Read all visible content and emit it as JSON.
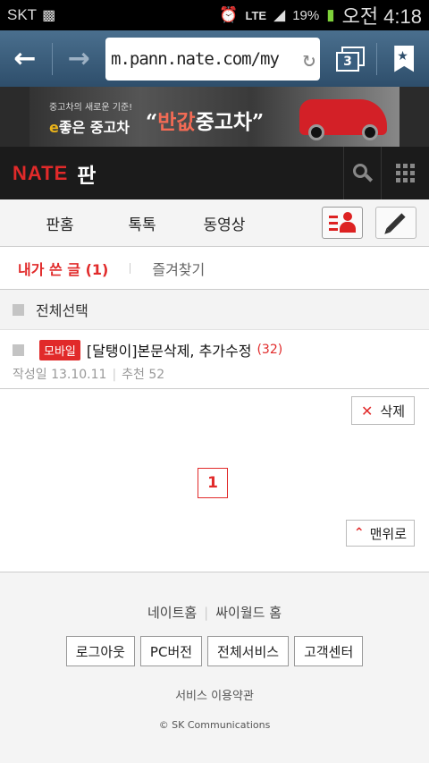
{
  "status_bar": {
    "carrier": "SKT",
    "network": "LTE",
    "battery": "19%",
    "clock": "오전 4:18",
    "icons": [
      "briefcase-icon",
      "alarm-icon",
      "signal-icon",
      "battery-icon"
    ]
  },
  "browser": {
    "url": "m.pann.nate.com/my",
    "tab_count": "3",
    "icons": [
      "back-arrow-icon",
      "forward-arrow-icon",
      "reload-icon",
      "tabs-icon",
      "bookmark-icon"
    ]
  },
  "ad": {
    "small_text": "중고차의 새로운 기준!",
    "big_prefix": "e",
    "big_text": "좋은 중고차",
    "slogan_open": "“",
    "slogan_highlight": "반값",
    "slogan_rest": "중고차",
    "slogan_close": "”"
  },
  "header": {
    "logo": "NATE",
    "service": "판",
    "icons": [
      "search-icon",
      "grid-menu-icon"
    ]
  },
  "main_nav": {
    "items": [
      {
        "label": "판홈"
      },
      {
        "label": "톡톡"
      },
      {
        "label": "동영상"
      }
    ],
    "icons": [
      "my-page-icon",
      "write-pencil-icon"
    ]
  },
  "sub_tabs": {
    "active": "내가 쓴 글 (1)",
    "inactive": "즐겨찾기"
  },
  "list": {
    "select_all": "전체선택",
    "posts": [
      {
        "badge": "모바일",
        "title": "[달탱이]본문삭제, 추가수정",
        "comment_count": "(32)",
        "date_label": "작성일 13.10.11",
        "recommend_label": "추천 52"
      }
    ]
  },
  "actions": {
    "delete": "삭제",
    "page": "1",
    "top": "맨위로"
  },
  "footer": {
    "link_nate": "네이트홈",
    "link_cyworld": "싸이월드 홈",
    "buttons": [
      "로그아웃",
      "PC버전",
      "전체서비스",
      "고객센터"
    ],
    "terms": "서비스 이용약관",
    "copyright": "© SK Communications"
  },
  "colors": {
    "accent": "#e12a2a",
    "header_bg": "#1b1b1b",
    "browser_bg": "#3a5f80"
  }
}
